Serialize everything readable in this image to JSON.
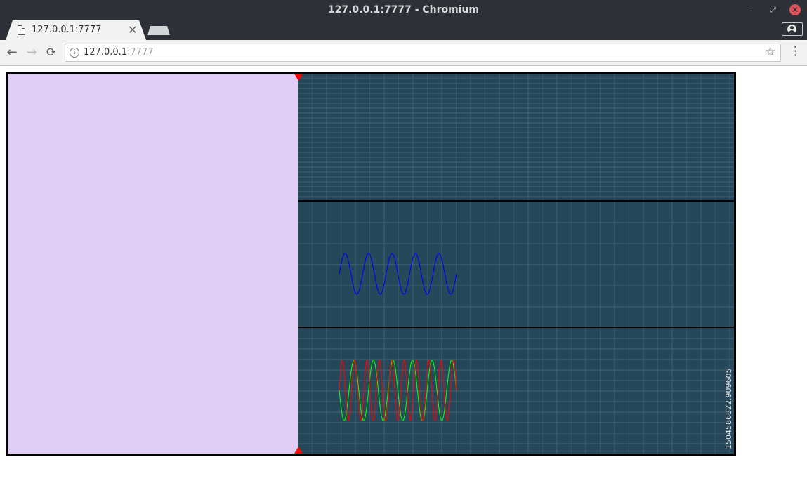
{
  "window": {
    "title": "127.0.0.1:7777 - Chromium",
    "controls": {
      "minimize": "–",
      "maximize": "⤢",
      "close": "✕"
    }
  },
  "tabs": [
    {
      "label": "127.0.0.1:7777",
      "icon": "page-icon",
      "close": "✕",
      "active": true
    }
  ],
  "toolbar": {
    "back": "←",
    "forward": "→",
    "reload": "⟳",
    "address": {
      "host": "127.0.0.1",
      "port": ":7777"
    },
    "info": "i",
    "bookmark": "☆",
    "menu": "⋮"
  },
  "app": {
    "side_panel_color": "#e0cdf6",
    "plot_background": "#26485a",
    "grid_color": "#4f6d7d",
    "marker_color": "#ff0000",
    "timestamp": "1504586822.909605",
    "plots": [
      {
        "name": "top-plot",
        "traces": []
      },
      {
        "name": "middle-plot",
        "traces": [
          {
            "color": "#0000ff",
            "cycles": 5
          }
        ]
      },
      {
        "name": "bottom-plot",
        "traces": [
          {
            "color": "#00ff00",
            "cycles": 6
          },
          {
            "color": "#ff0000",
            "cycles": 9.5
          }
        ]
      }
    ]
  }
}
